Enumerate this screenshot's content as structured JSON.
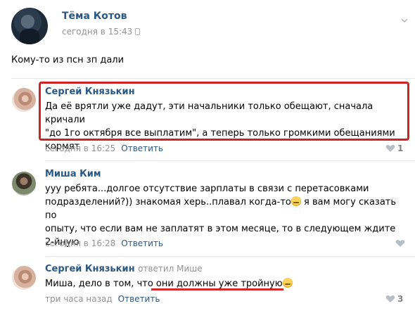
{
  "post": {
    "author": "Тёма Котов",
    "time": "сегодня в 15:43",
    "text": "Кому-то из псн зп дали"
  },
  "comments": [
    {
      "author": "Сергей Князькин",
      "lines": [
        "Да её врятли уже дадут, эти начальники только обещают, сначала кричали",
        "\"до 1го октября все выплатим\", а теперь только громкими обещаниями",
        "кормят"
      ],
      "time": "сегодня в 16:25",
      "reply_label": "Ответить",
      "likes": "1"
    },
    {
      "author": "Миша Ким",
      "lines": [
        "ууу ребята...долгое отсутствие зарплаты в связи с перетасовками",
        "подразделений?)) знакомая херь..плавал когда-то",
        " я вам могу сказать по",
        "опыту, что если вам не заплатят в этом месяце, то в следующем ждите",
        "2-йную"
      ],
      "time": "сегодня в 16:28",
      "reply_label": "Ответить"
    },
    {
      "author": "Сергей Князькин",
      "replied_to": "ответил Мише",
      "text_start": "Миша, дело в том, что ",
      "text_highlight": "они должны уже тройную",
      "time": "три часа назад",
      "reply_label": "Ответить",
      "likes": "3"
    }
  ],
  "icons": {
    "heart": "heart-icon",
    "chevron": "chevron-down-icon",
    "emoji": "smiley-emoji-icon",
    "device": "mobile-device-icon"
  },
  "colors": {
    "link": "#2a5885",
    "meta": "#939393",
    "highlight": "#cf2222"
  }
}
